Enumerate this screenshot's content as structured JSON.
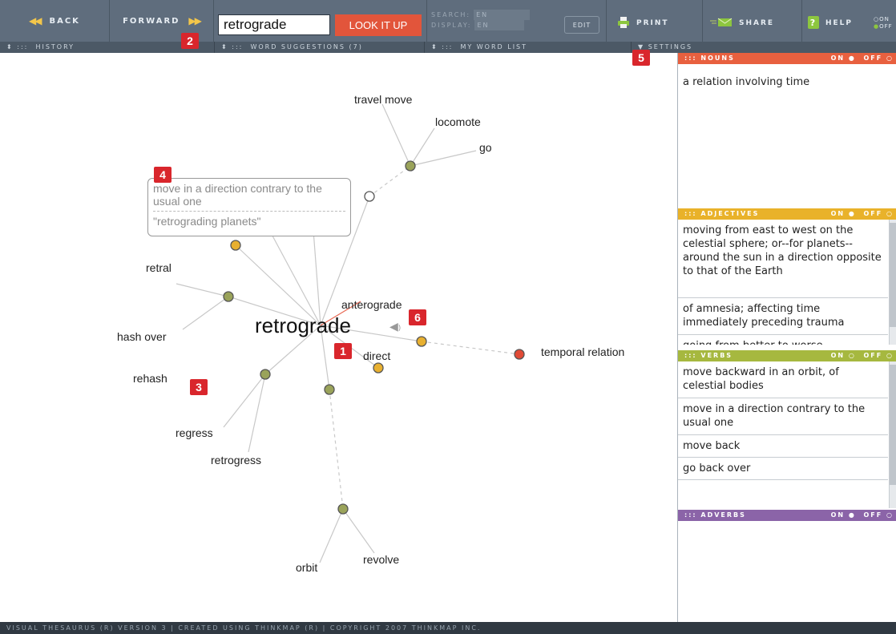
{
  "toolbar": {
    "back_label": "BACK",
    "forward_label": "FORWARD",
    "search_value": "retrograde",
    "lookup_label": "LOOK IT UP",
    "search_lang_label": "SEARCH:",
    "search_lang_value": "EN",
    "display_lang_label": "DISPLAY:",
    "display_lang_value": "EN",
    "edit_label": "EDIT",
    "print_label": "PRINT",
    "share_label": "SHARE",
    "help_label": "HELP",
    "on_label": "ON",
    "off_label": "OFF"
  },
  "panel_bar": {
    "history": "HISTORY",
    "word_suggestions": "WORD SUGGESTIONS (7)",
    "word_list": "MY WORD LIST",
    "settings": "SETTINGS"
  },
  "graph": {
    "center_word": "retrograde",
    "words": {
      "travel_move": "travel move",
      "locomote": "locomote",
      "go": "go",
      "retral": "retral",
      "anterograde": "anterograde",
      "hash_over": "hash over",
      "direct": "direct",
      "temporal_relation": "temporal relation",
      "rehash": "rehash",
      "regress": "regress",
      "retrogress": "retrogress",
      "orbit": "orbit",
      "revolve": "revolve"
    },
    "tooltip": {
      "definition": "move in a direction contrary to the usual one",
      "example": "\"retrograding planets\""
    },
    "node_colors": {
      "noun": "#e04a35",
      "adjective": "#e8b030",
      "verb": "#9aa35a",
      "empty": "#ffffff"
    }
  },
  "markers": [
    "1",
    "2",
    "3",
    "4",
    "5",
    "6"
  ],
  "right": {
    "nouns": {
      "title": "NOUNS",
      "color": "#e8603f",
      "on": "ON",
      "off": "OFF",
      "definitions": [
        "a relation involving time"
      ]
    },
    "adjectives": {
      "title": "ADJECTIVES",
      "color": "#e9b22a",
      "on": "ON",
      "off": "OFF",
      "definitions": [
        "moving from east to west on the celestial sphere; or--for planets--around the sun in a direction opposite to that of the Earth",
        "of amnesia; affecting time immediately preceding trauma",
        "going from better to worse"
      ]
    },
    "verbs": {
      "title": "VERBS",
      "color": "#a6b83f",
      "on": "ON",
      "off": "OFF",
      "definitions": [
        "move backward in an orbit, of celestial bodies",
        "move in a direction contrary to the usual one",
        "move back",
        "go back over"
      ]
    },
    "adverbs": {
      "title": "ADVERBS",
      "color": "#8b64a8",
      "on": "ON",
      "off": "OFF",
      "definitions": []
    }
  },
  "footer": {
    "text": "VISUAL THESAURUS (R) VERSION 3 | CREATED USING THINKMAP (R) | COPYRIGHT 2007 THINKMAP INC."
  }
}
